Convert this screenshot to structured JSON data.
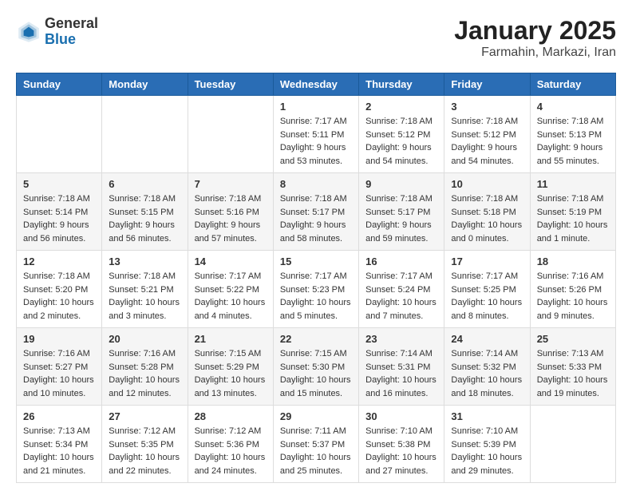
{
  "header": {
    "logo_general": "General",
    "logo_blue": "Blue",
    "title": "January 2025",
    "subtitle": "Farmahin, Markazi, Iran"
  },
  "days_of_week": [
    "Sunday",
    "Monday",
    "Tuesday",
    "Wednesday",
    "Thursday",
    "Friday",
    "Saturday"
  ],
  "weeks": [
    [
      {
        "day": "",
        "info": ""
      },
      {
        "day": "",
        "info": ""
      },
      {
        "day": "",
        "info": ""
      },
      {
        "day": "1",
        "info": "Sunrise: 7:17 AM\nSunset: 5:11 PM\nDaylight: 9 hours and 53 minutes."
      },
      {
        "day": "2",
        "info": "Sunrise: 7:18 AM\nSunset: 5:12 PM\nDaylight: 9 hours and 54 minutes."
      },
      {
        "day": "3",
        "info": "Sunrise: 7:18 AM\nSunset: 5:12 PM\nDaylight: 9 hours and 54 minutes."
      },
      {
        "day": "4",
        "info": "Sunrise: 7:18 AM\nSunset: 5:13 PM\nDaylight: 9 hours and 55 minutes."
      }
    ],
    [
      {
        "day": "5",
        "info": "Sunrise: 7:18 AM\nSunset: 5:14 PM\nDaylight: 9 hours and 56 minutes."
      },
      {
        "day": "6",
        "info": "Sunrise: 7:18 AM\nSunset: 5:15 PM\nDaylight: 9 hours and 56 minutes."
      },
      {
        "day": "7",
        "info": "Sunrise: 7:18 AM\nSunset: 5:16 PM\nDaylight: 9 hours and 57 minutes."
      },
      {
        "day": "8",
        "info": "Sunrise: 7:18 AM\nSunset: 5:17 PM\nDaylight: 9 hours and 58 minutes."
      },
      {
        "day": "9",
        "info": "Sunrise: 7:18 AM\nSunset: 5:17 PM\nDaylight: 9 hours and 59 minutes."
      },
      {
        "day": "10",
        "info": "Sunrise: 7:18 AM\nSunset: 5:18 PM\nDaylight: 10 hours and 0 minutes."
      },
      {
        "day": "11",
        "info": "Sunrise: 7:18 AM\nSunset: 5:19 PM\nDaylight: 10 hours and 1 minute."
      }
    ],
    [
      {
        "day": "12",
        "info": "Sunrise: 7:18 AM\nSunset: 5:20 PM\nDaylight: 10 hours and 2 minutes."
      },
      {
        "day": "13",
        "info": "Sunrise: 7:18 AM\nSunset: 5:21 PM\nDaylight: 10 hours and 3 minutes."
      },
      {
        "day": "14",
        "info": "Sunrise: 7:17 AM\nSunset: 5:22 PM\nDaylight: 10 hours and 4 minutes."
      },
      {
        "day": "15",
        "info": "Sunrise: 7:17 AM\nSunset: 5:23 PM\nDaylight: 10 hours and 5 minutes."
      },
      {
        "day": "16",
        "info": "Sunrise: 7:17 AM\nSunset: 5:24 PM\nDaylight: 10 hours and 7 minutes."
      },
      {
        "day": "17",
        "info": "Sunrise: 7:17 AM\nSunset: 5:25 PM\nDaylight: 10 hours and 8 minutes."
      },
      {
        "day": "18",
        "info": "Sunrise: 7:16 AM\nSunset: 5:26 PM\nDaylight: 10 hours and 9 minutes."
      }
    ],
    [
      {
        "day": "19",
        "info": "Sunrise: 7:16 AM\nSunset: 5:27 PM\nDaylight: 10 hours and 10 minutes."
      },
      {
        "day": "20",
        "info": "Sunrise: 7:16 AM\nSunset: 5:28 PM\nDaylight: 10 hours and 12 minutes."
      },
      {
        "day": "21",
        "info": "Sunrise: 7:15 AM\nSunset: 5:29 PM\nDaylight: 10 hours and 13 minutes."
      },
      {
        "day": "22",
        "info": "Sunrise: 7:15 AM\nSunset: 5:30 PM\nDaylight: 10 hours and 15 minutes."
      },
      {
        "day": "23",
        "info": "Sunrise: 7:14 AM\nSunset: 5:31 PM\nDaylight: 10 hours and 16 minutes."
      },
      {
        "day": "24",
        "info": "Sunrise: 7:14 AM\nSunset: 5:32 PM\nDaylight: 10 hours and 18 minutes."
      },
      {
        "day": "25",
        "info": "Sunrise: 7:13 AM\nSunset: 5:33 PM\nDaylight: 10 hours and 19 minutes."
      }
    ],
    [
      {
        "day": "26",
        "info": "Sunrise: 7:13 AM\nSunset: 5:34 PM\nDaylight: 10 hours and 21 minutes."
      },
      {
        "day": "27",
        "info": "Sunrise: 7:12 AM\nSunset: 5:35 PM\nDaylight: 10 hours and 22 minutes."
      },
      {
        "day": "28",
        "info": "Sunrise: 7:12 AM\nSunset: 5:36 PM\nDaylight: 10 hours and 24 minutes."
      },
      {
        "day": "29",
        "info": "Sunrise: 7:11 AM\nSunset: 5:37 PM\nDaylight: 10 hours and 25 minutes."
      },
      {
        "day": "30",
        "info": "Sunrise: 7:10 AM\nSunset: 5:38 PM\nDaylight: 10 hours and 27 minutes."
      },
      {
        "day": "31",
        "info": "Sunrise: 7:10 AM\nSunset: 5:39 PM\nDaylight: 10 hours and 29 minutes."
      },
      {
        "day": "",
        "info": ""
      }
    ]
  ]
}
